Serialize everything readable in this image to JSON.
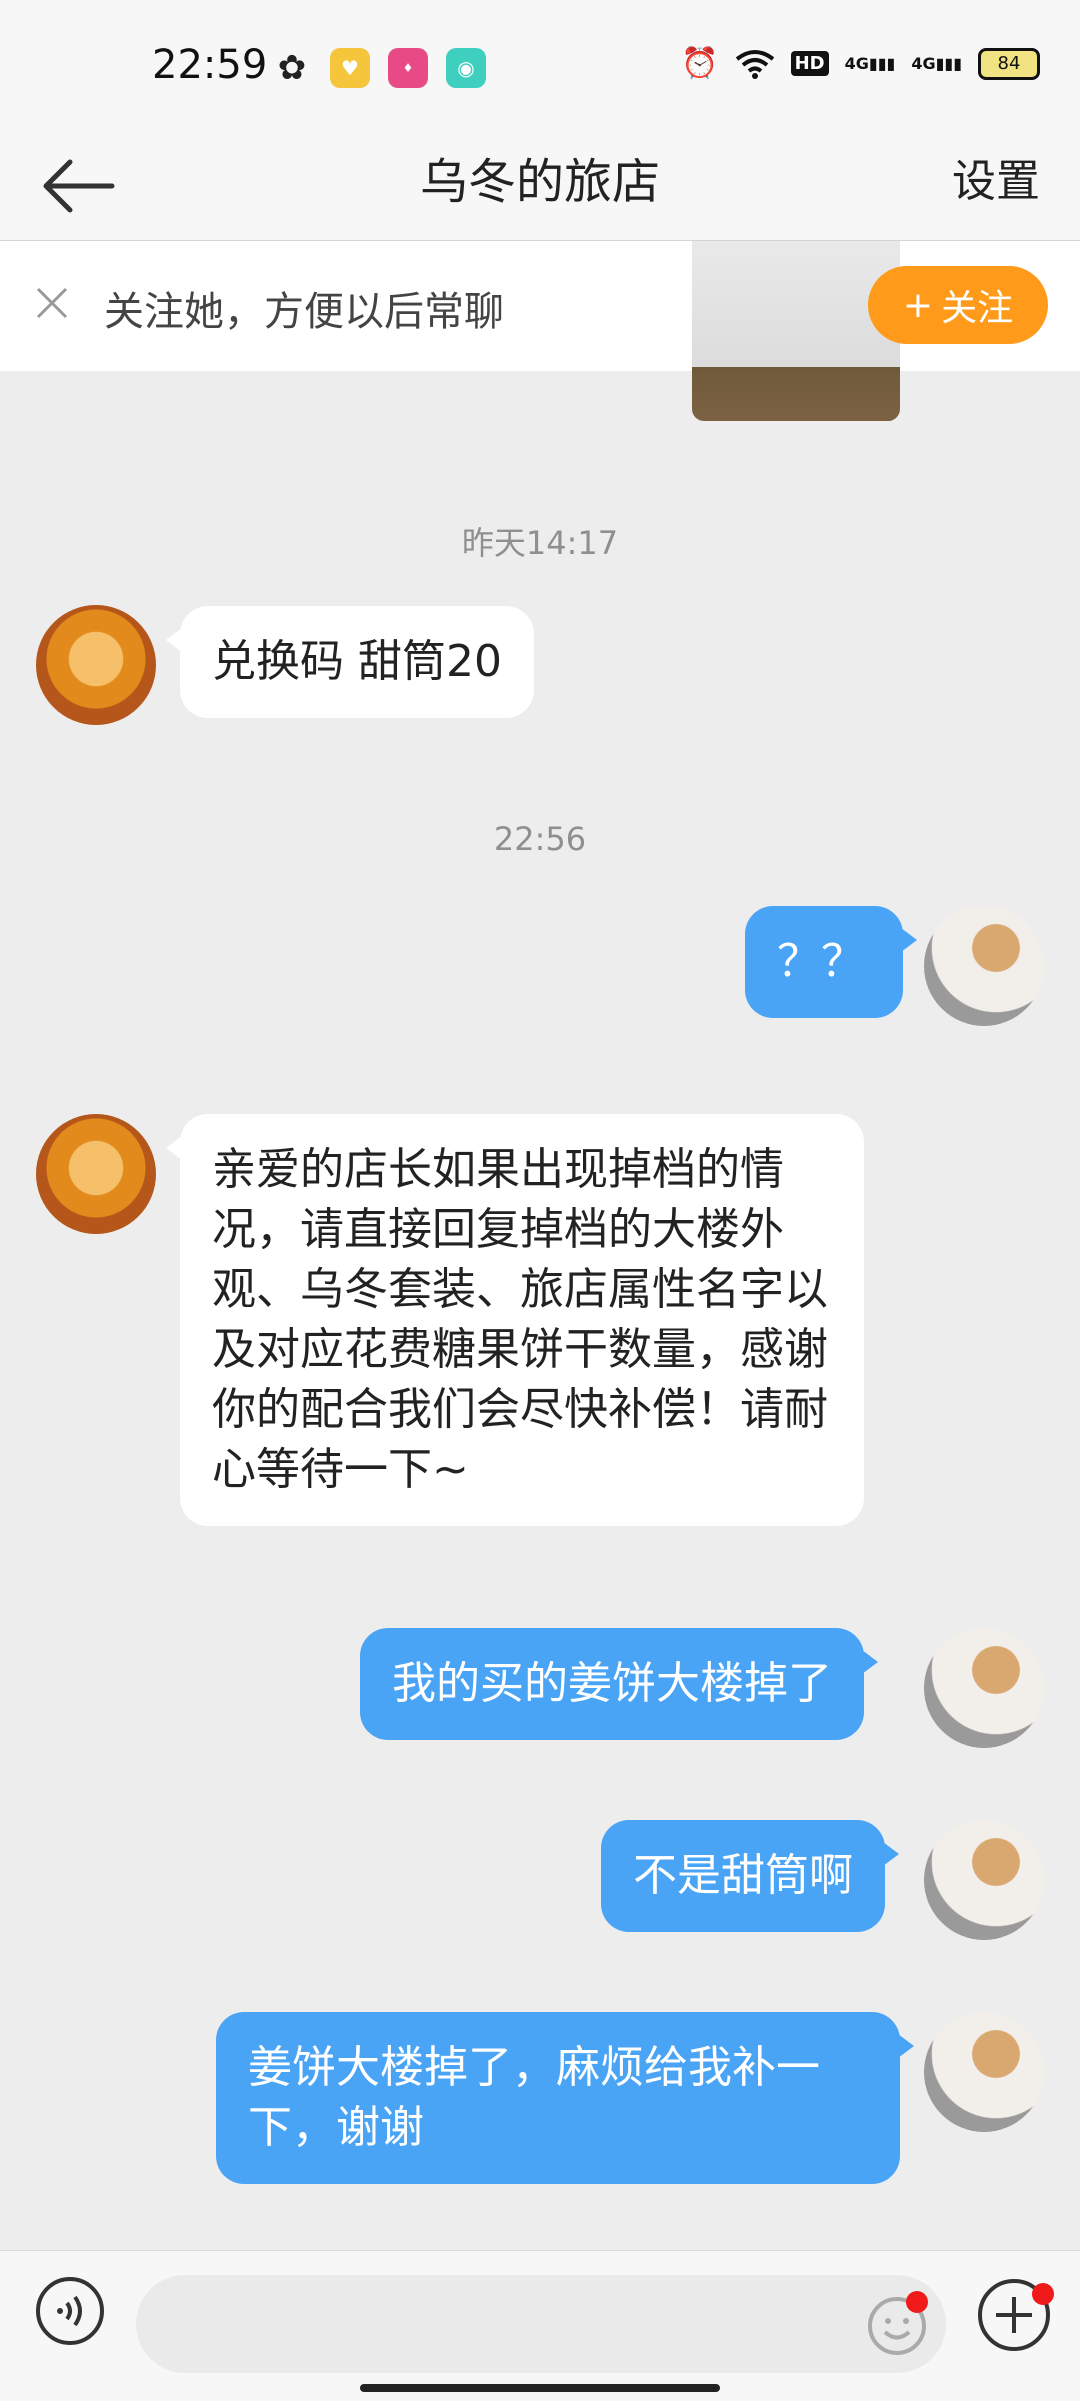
{
  "status_bar": {
    "time": "22:59",
    "battery": "84",
    "hd_label": "HD",
    "signal_label": "4G"
  },
  "header": {
    "title": "乌冬的旅店",
    "settings_label": "设置"
  },
  "follow_bar": {
    "text": "关注她，方便以后常聊",
    "button_label": "关注",
    "button_icon": "+"
  },
  "messages": [
    {
      "type": "timestamp",
      "text": "昨天14:17"
    },
    {
      "type": "incoming",
      "text": "兑换码 甜筒20"
    },
    {
      "type": "timestamp",
      "text": "22:56"
    },
    {
      "type": "outgoing",
      "text": "？？"
    },
    {
      "type": "incoming",
      "text": "亲爱的店长如果出现掉档的情况，请直接回复掉档的大楼外观、乌冬套装、旅店属性名字以及对应花费糖果饼干数量，感谢你的配合我们会尽快补偿！请耐心等待一下~"
    },
    {
      "type": "outgoing",
      "text": "我的买的姜饼大楼掉了"
    },
    {
      "type": "outgoing",
      "text": "不是甜筒啊"
    },
    {
      "type": "outgoing",
      "text": "姜饼大楼掉了，麻烦给我补一下，谢谢"
    }
  ],
  "input_bar": {
    "placeholder": ""
  },
  "colors": {
    "accent_orange": "#ff9a1a",
    "bubble_blue": "#4aa4f5",
    "chat_bg": "#ededed"
  }
}
